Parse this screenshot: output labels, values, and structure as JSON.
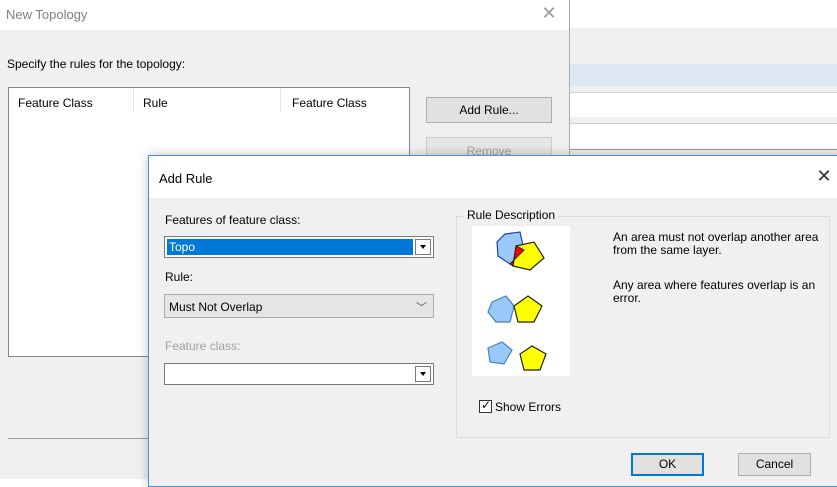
{
  "new_topology": {
    "title": "New Topology",
    "prompt": "Specify the rules for the topology:",
    "columns": [
      "Feature Class",
      "Rule",
      "Feature Class"
    ],
    "add_rule_label": "Add Rule...",
    "remove_label": "Remove"
  },
  "add_rule": {
    "title": "Add Rule",
    "features_label": "Features of feature class:",
    "features_value": "Topo",
    "rule_label": "Rule:",
    "rule_value": "Must Not Overlap",
    "feature_class_label": "Feature class:",
    "feature_class_value": "",
    "rule_description_label": "Rule Description",
    "description_1": "An area must not overlap another area from the same layer.",
    "description_2": "Any area where features overlap is an error.",
    "show_errors_label": "Show Errors",
    "show_errors_checked": true,
    "ok_label": "OK",
    "cancel_label": "Cancel"
  },
  "colors": {
    "accent": "#0078d7",
    "polygon_blue": "#99c9f7",
    "polygon_yellow": "#ffff00",
    "error_red": "#ff0000"
  }
}
